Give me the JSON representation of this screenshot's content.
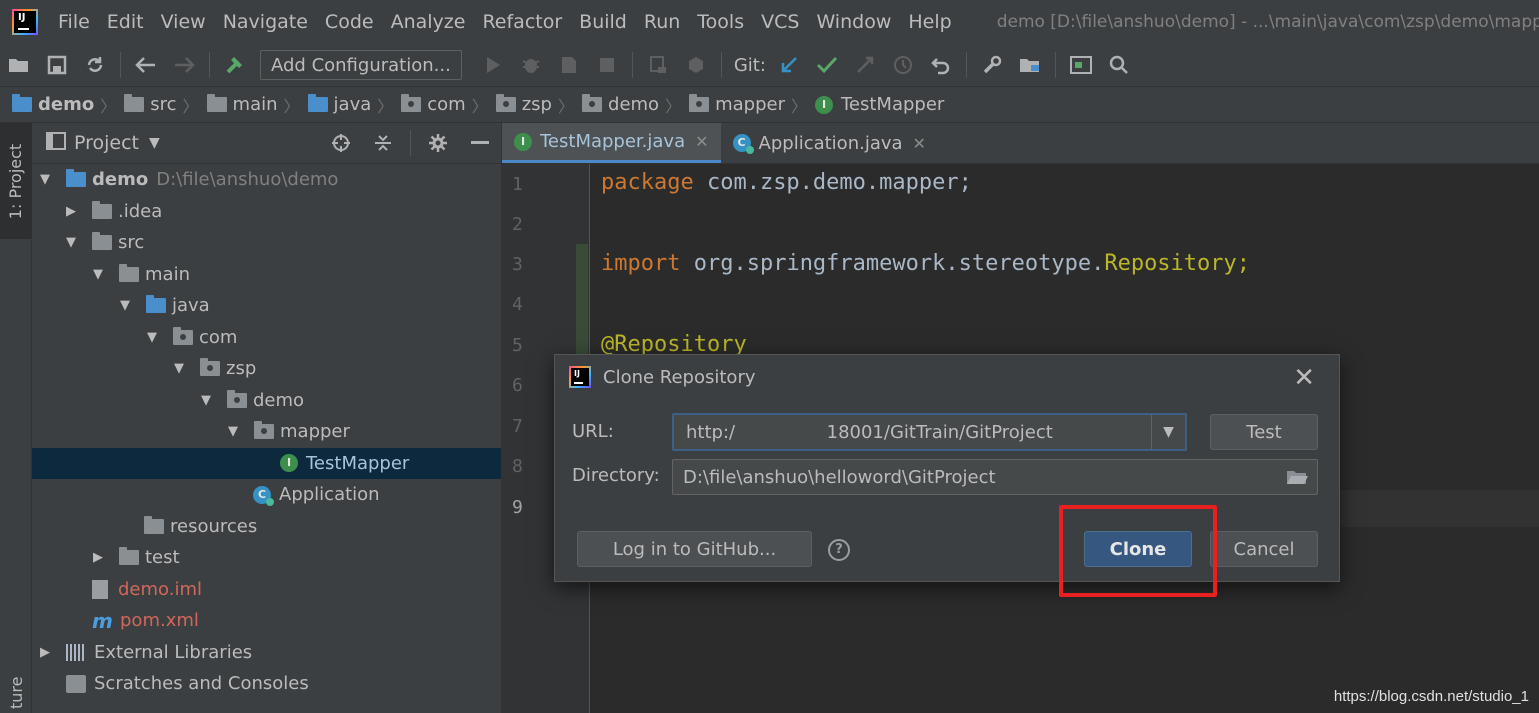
{
  "menubar": {
    "items": [
      "File",
      "Edit",
      "View",
      "Navigate",
      "Code",
      "Analyze",
      "Refactor",
      "Build",
      "Run",
      "Tools",
      "VCS",
      "Window",
      "Help"
    ],
    "window_title": "demo [D:\\file\\anshuo\\demo] - ...\\main\\java\\com\\zsp\\demo\\mapper"
  },
  "toolbar": {
    "config_label": "Add Configuration...",
    "git_label": "Git:"
  },
  "breadcrumb": [
    "demo",
    "src",
    "main",
    "java",
    "com",
    "zsp",
    "demo",
    "mapper",
    "TestMapper"
  ],
  "left_strip": {
    "project_tab": "1: Project",
    "bottom_tab": "ture"
  },
  "project_panel": {
    "title": "Project",
    "tree": [
      {
        "label": "demo",
        "path": "D:\\file\\anshuo\\demo"
      },
      {
        "label": ".idea"
      },
      {
        "label": "src"
      },
      {
        "label": "main"
      },
      {
        "label": "java"
      },
      {
        "label": "com"
      },
      {
        "label": "zsp"
      },
      {
        "label": "demo"
      },
      {
        "label": "mapper"
      },
      {
        "label": "TestMapper"
      },
      {
        "label": "Application"
      },
      {
        "label": "resources"
      },
      {
        "label": "test"
      },
      {
        "label": "demo.iml"
      },
      {
        "label": "pom.xml"
      },
      {
        "label": "External Libraries"
      },
      {
        "label": "Scratches and Consoles"
      }
    ]
  },
  "editor": {
    "tabs": [
      {
        "label": "TestMapper.java"
      },
      {
        "label": "Application.java"
      }
    ],
    "line_numbers": [
      "1",
      "2",
      "3",
      "4",
      "5",
      "6",
      "7",
      "8",
      "9"
    ],
    "code": {
      "l1_kw": "package",
      "l1_rest": " com.zsp.demo.mapper;",
      "l3_kw": "import",
      "l3_mid": " org.springframework.stereotype.",
      "l3_cls": "Repository;",
      "l5_ann": "@Repository"
    }
  },
  "dialog": {
    "title": "Clone Repository",
    "url_label": "URL:",
    "url_value": "http:/                18001/GitTrain/GitProject",
    "directory_label": "Directory:",
    "directory_value": "D:\\file\\anshuo\\helloword\\GitProject",
    "test_button": "Test",
    "github_button": "Log in to GitHub...",
    "clone_button": "Clone",
    "cancel_button": "Cancel",
    "help_glyph": "?"
  },
  "watermark": "https://blog.csdn.net/studio_1",
  "colors": {
    "accent": "#365880",
    "highlight": "#e82020"
  }
}
